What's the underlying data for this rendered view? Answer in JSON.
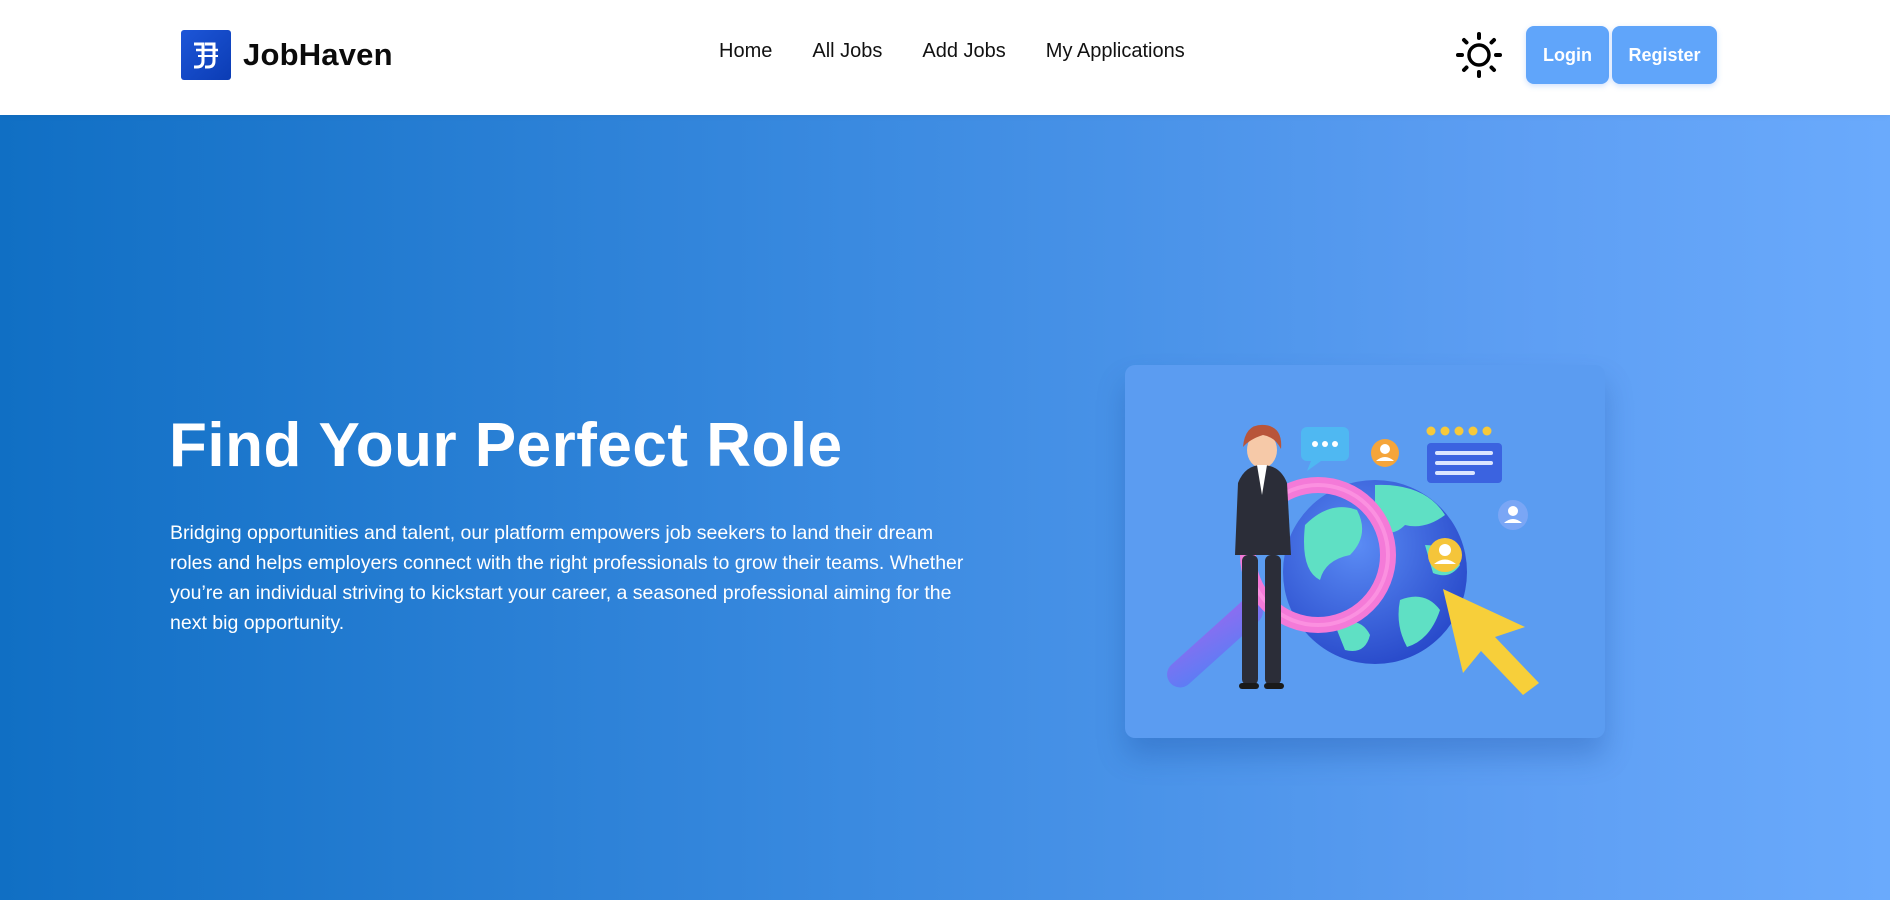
{
  "brand": {
    "name": "JobHaven",
    "logo_icon": "job-haven-logo-icon",
    "logo_color": "#1d56d8"
  },
  "nav": {
    "items": [
      {
        "label": "Home"
      },
      {
        "label": "All Jobs"
      },
      {
        "label": "Add Jobs"
      },
      {
        "label": "My Applications"
      }
    ]
  },
  "header": {
    "theme_icon": "sun-icon",
    "login_label": "Login",
    "register_label": "Register",
    "button_color": "#60a5fa"
  },
  "hero": {
    "title": "Find Your Perfect Role",
    "description": "Bridging opportunities and talent, our platform empowers job seekers to land their dream roles and helps employers connect with the right professionals to grow their teams. Whether you’re an individual striving to kickstart your career, a seasoned professional aiming for the next big opportunity.",
    "gradient_start": "#106fc4",
    "gradient_end": "#6aaafc",
    "illustration": "job-search-globe-illustration"
  }
}
